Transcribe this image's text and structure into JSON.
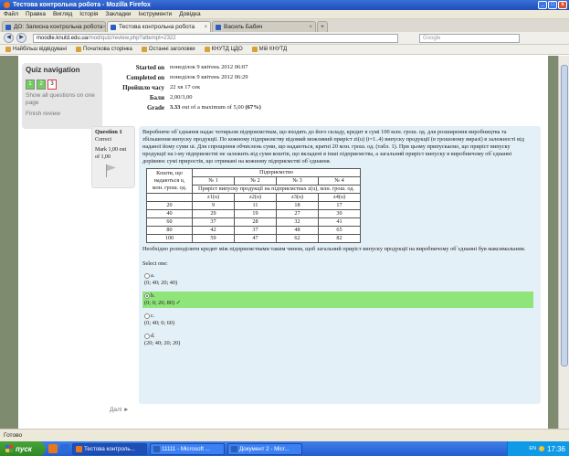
{
  "window": {
    "title": "Тестова контрольна робота - Mozilla Firefox",
    "btn_min": "_",
    "btn_max": "□",
    "btn_close": "x"
  },
  "menu": [
    "Файл",
    "Правка",
    "Вигляд",
    "Історія",
    "Закладки",
    "Інструменти",
    "Довідка"
  ],
  "tabs": [
    {
      "label": "ДО: Записна контрольна робота",
      "active": false
    },
    {
      "label": "Тестова контрольна робота",
      "active": true
    },
    {
      "label": "Василь Бабич",
      "active": false
    }
  ],
  "tab_close": "×",
  "tab_new": "+",
  "nav": {
    "back": "◀",
    "forward": "▶",
    "url_host": "moodle.knutd.edu.ua",
    "url_path": "/mod/quiz/review.php?attempt=2322",
    "search_placeholder": "Google"
  },
  "bookmarks": [
    "Найбільш відвідувані",
    "Початкова сторінка",
    "Останні заголовки",
    "КНУТД ЦДО",
    "Мій КНУТД"
  ],
  "quiz_nav": {
    "title": "Quiz navigation",
    "buttons": [
      "1",
      "2",
      "3"
    ],
    "show_all": "Show all questions on one page",
    "finish": "Finish review"
  },
  "summary": {
    "started_label": "Started on",
    "started_value": "понеділок 9 квітень 2012 06:07",
    "completed_label": "Completed on",
    "completed_value": "понеділок 9 квітень 2012 06:29",
    "elapsed_label": "Пройшло часу",
    "elapsed_value": "22 хв 17 сек",
    "marks_label": "Бали",
    "marks_value": "2,00/3,00",
    "grade_label": "Grade",
    "grade_score": "3.33",
    "grade_rest": " out of a maximum of 5,00 ",
    "grade_percent": "(67%)"
  },
  "question": {
    "number": "Question 1",
    "status": "Correct",
    "mark": "Mark 1,00 out of 1,00",
    "text": "Виробниче об`єднання надає чотирьом підприємствам, що входять до його складу, кредит в сумі 100 млн. грош. од. для розширення виробництва та збільшення випуску продукції. По кожному підприємству відомий можливий приріст zi(u) (i=1..4) випуску продукції (в грошовому виразі) в залежності від наданої йому суми ui. Для спрощення обчислень суми, що надаються, кратні 20 млн. грош. од. (табл. 1). При цьому припускаємо, що приріст випуску продукції на i-му підприємстві не залежить від суми коштів, що вкладені в інші підприємства, а загальний приріст випуску в виробничому об`єднанні дорівнює сумі приростів, що отримані на кожному підприємстві об`єднання.",
    "table": {
      "header_left": "Кошти, що надаються u, млн. грош. од.",
      "header_top": "Підприємство",
      "enterprises": [
        "№ 1",
        "№ 2",
        "№ 3",
        "№ 4"
      ],
      "growth_label": "Приріст випуску продукції на підприємствах z(u), млн. грош. од.",
      "fn_labels": [
        "z1(u)",
        "z2(u)",
        "z3(u)",
        "z4(u)"
      ],
      "rows": [
        [
          "20",
          "9",
          "11",
          "18",
          "17"
        ],
        [
          "40",
          "29",
          "19",
          "27",
          "30"
        ],
        [
          "60",
          "37",
          "28",
          "32",
          "41"
        ],
        [
          "80",
          "42",
          "37",
          "48",
          "65"
        ],
        [
          "100",
          "59",
          "47",
          "62",
          "82"
        ]
      ]
    },
    "prompt": "Необхідно розподілити кредит між підприємствами таким чином, щоб загальний приріст випуску продукції на виробничому об`єднанні був максимальним.",
    "select_one": "Select one:",
    "options": [
      {
        "letter": "a.",
        "value": "(0; 40; 20; 40)",
        "selected": false
      },
      {
        "letter": "b.",
        "value": "(0; 0; 20; 80)",
        "selected": true,
        "tick": "✓"
      },
      {
        "letter": "c.",
        "value": "(0; 40; 0; 60)",
        "selected": false
      },
      {
        "letter": "d.",
        "value": "(20; 40; 20; 20)",
        "selected": false
      }
    ]
  },
  "next_link": "Далі ►",
  "statusbar": "Готово",
  "taskbar": {
    "start": "пуск",
    "items": [
      "Тестова контроль...",
      "11111 - Microsoft ...",
      "Документ 2 - Micr..."
    ],
    "lang": "EN",
    "time": "17:36"
  },
  "colors": {
    "accent": "#2a5ec4",
    "correct": "#8fe57a",
    "page_bg": "#7e8b6e",
    "question_bg": "#e4f0f7"
  }
}
